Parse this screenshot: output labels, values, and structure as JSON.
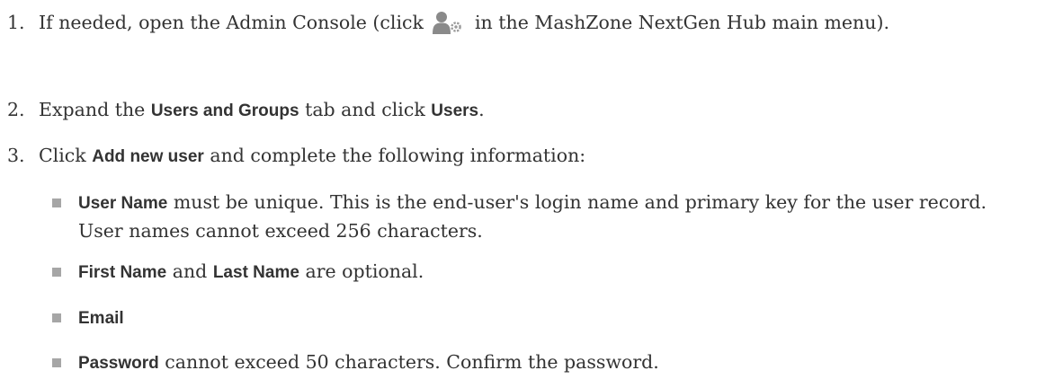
{
  "steps": [
    {
      "number": "1.",
      "text_before_icon": "If needed, open the Admin Console (click",
      "icon": "admin-console-icon",
      "text_after_icon": "in the MashZone NextGen Hub main menu)."
    },
    {
      "number": "2.",
      "part1": "Expand the",
      "kw1": "Users and Groups",
      "part2": "tab and click",
      "kw2": "Users",
      "part3": "."
    },
    {
      "number": "3.",
      "part1": "Click",
      "kw1": "Add new user",
      "part2": "and complete the following information:",
      "bullets": [
        {
          "kw1": "User Name",
          "text": "must be unique. This is the end-user's login name and primary key for the user record. User names cannot exceed 256 characters."
        },
        {
          "kw1": "First Name",
          "mid": "and",
          "kw2": "Last Name",
          "text": "are optional."
        },
        {
          "kw1": "Email"
        },
        {
          "kw1": "Password",
          "text": "cannot exceed 50 characters. Confirm the password."
        }
      ]
    }
  ],
  "colors": {
    "text": "#333333",
    "bullet": "#a6a6a6",
    "icon": "#8a8a8a"
  }
}
